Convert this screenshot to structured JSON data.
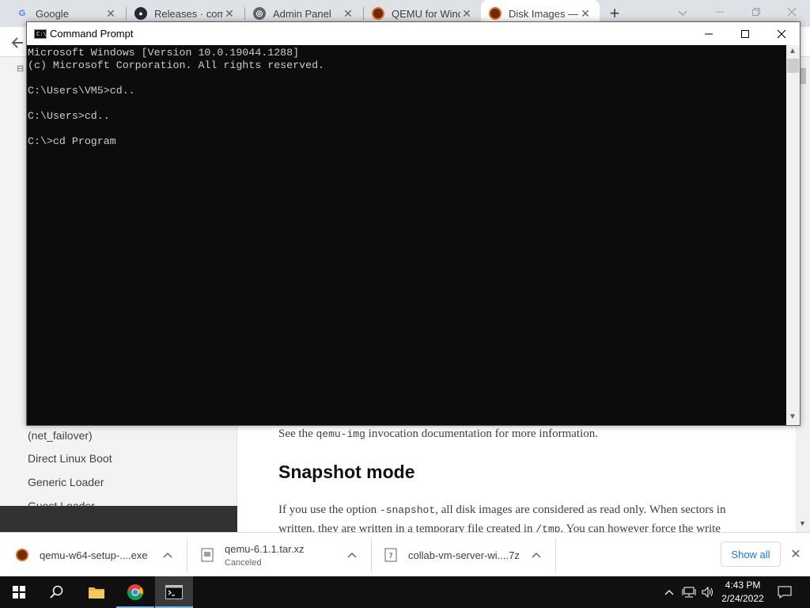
{
  "browser": {
    "tabs": [
      {
        "title": "Google",
        "icon": "google-icon"
      },
      {
        "title": "Releases · comp",
        "icon": "github-icon"
      },
      {
        "title": "Admin Panel",
        "icon": "globe-icon"
      },
      {
        "title": "QEMU for Wind",
        "icon": "qemu-icon"
      },
      {
        "title": "Disk Images —",
        "icon": "qemu-icon",
        "active": true
      }
    ],
    "accent_color": "#1a73e8"
  },
  "page": {
    "sidebar": {
      "items": [
        {
          "label": "(net_failover)"
        },
        {
          "label": "Direct Linux Boot"
        },
        {
          "label": "Generic Loader"
        },
        {
          "label": "Guest Loader"
        }
      ]
    },
    "content": {
      "see_text_pre": "See the ",
      "see_code": "qemu-img",
      "see_text_post": " invocation documentation for more information.",
      "heading": "Snapshot mode",
      "para_1_pre": "If you use the option ",
      "para_1_code": "-snapshot",
      "para_1_post": ", all disk images are considered as read only. When sectors in",
      "para_2_pre": "written, they are written in a temporary file created in ",
      "para_2_code": "/tmp",
      "para_2_post": ". You can however force the write"
    }
  },
  "downloads": {
    "items": [
      {
        "name": "qemu-w64-setup-....exe",
        "status": ""
      },
      {
        "name": "qemu-6.1.1.tar.xz",
        "status": "Canceled"
      },
      {
        "name": "collab-vm-server-wi....7z",
        "status": ""
      }
    ],
    "show_all_label": "Show all"
  },
  "cmd": {
    "title": "Command Prompt",
    "lines": [
      "Microsoft Windows [Version 10.0.19044.1288]",
      "(c) Microsoft Corporation. All rights reserved.",
      "",
      "C:\\Users\\VM5>cd..",
      "",
      "C:\\Users>cd..",
      "",
      "C:\\>cd Program"
    ]
  },
  "taskbar": {
    "time": "4:43 PM",
    "date": "2/24/2022"
  }
}
